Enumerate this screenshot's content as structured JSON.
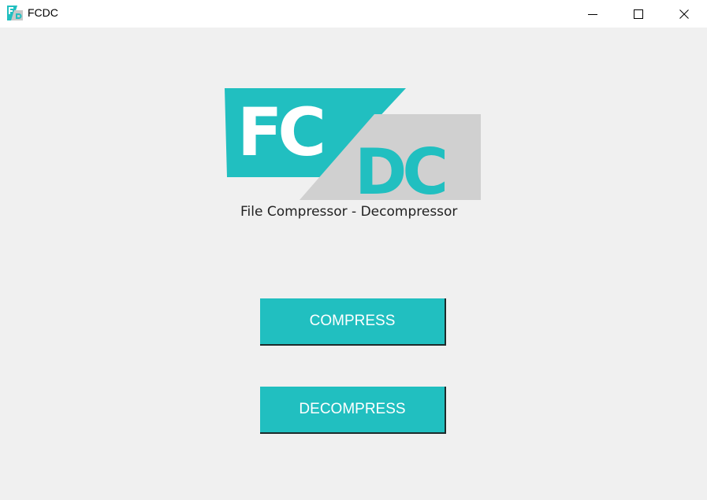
{
  "window": {
    "title": "FCDC",
    "app_icon": "fcdc-app-icon",
    "controls": {
      "minimize_icon": "minimize-icon",
      "maximize_icon": "maximize-icon",
      "close_icon": "close-icon"
    }
  },
  "logo": {
    "text_top": "FC",
    "text_bottom": "DC",
    "colors": {
      "teal": "#21bfc0",
      "gray": "#d0d0d0",
      "white": "#ffffff"
    }
  },
  "tagline": "File Compressor - Decompressor",
  "actions": {
    "compress_label": "COMPRESS",
    "decompress_label": "DECOMPRESS",
    "button_color": "#21bfc0"
  }
}
